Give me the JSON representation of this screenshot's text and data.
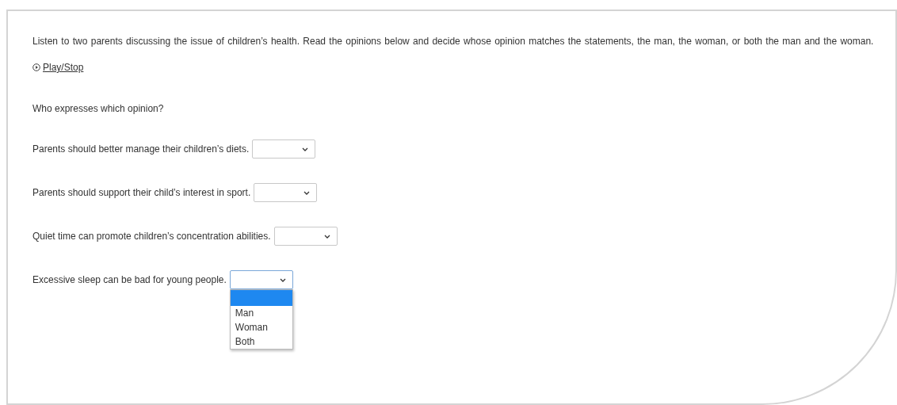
{
  "instructions": "Listen to two parents discussing the issue of children’s health. Read the opinions below and decide whose opinion matches the statements, the man, the woman, or both the man and the woman.",
  "play_link": "Play/Stop",
  "question": "Who expresses which opinion?",
  "items": [
    {
      "statement": "Parents should better manage their children’s diets.",
      "expanded": false
    },
    {
      "statement": "Parents should support their child’s interest in sport.",
      "expanded": false
    },
    {
      "statement": "Quiet time can promote children’s concentration abilities.",
      "expanded": false
    },
    {
      "statement": "Excessive sleep can be bad for young people.",
      "expanded": true
    }
  ],
  "dropdown_list": {
    "blank_option_selected": true,
    "options": [
      {
        "label": "Man",
        "selected": false
      },
      {
        "label": "Woman",
        "selected": false
      },
      {
        "label": "Both",
        "selected": false
      }
    ]
  }
}
